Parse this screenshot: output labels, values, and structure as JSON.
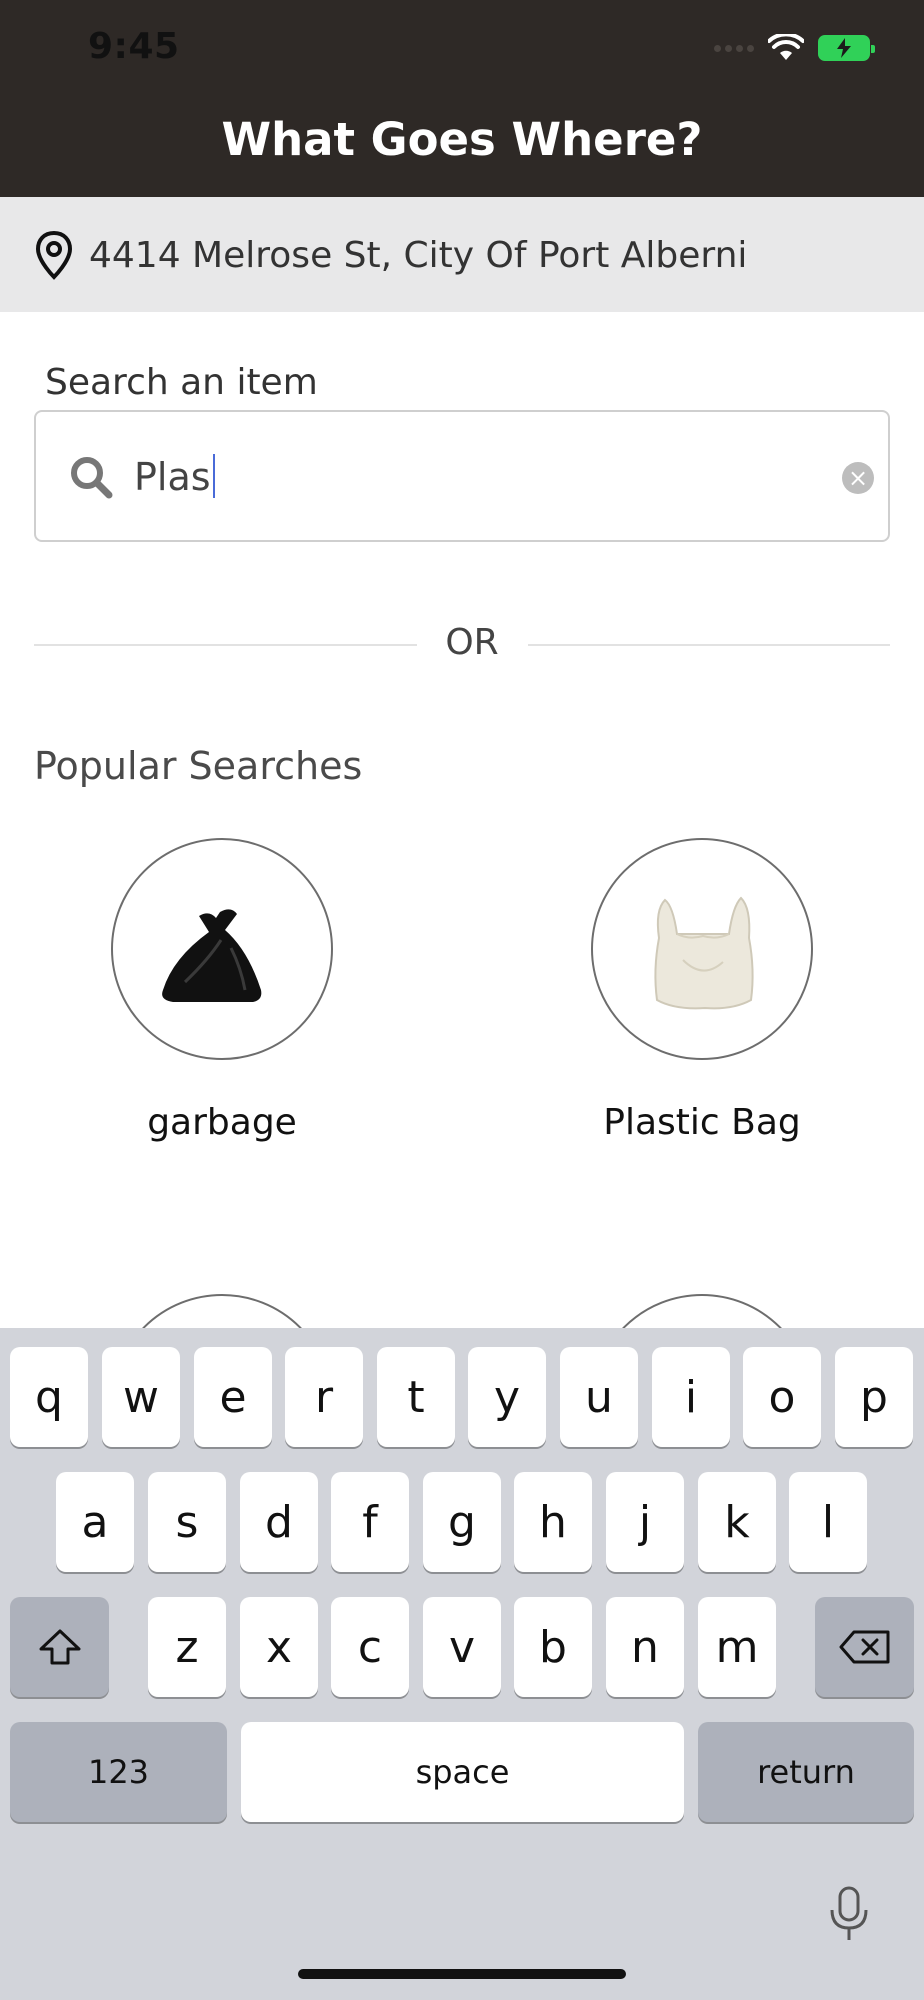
{
  "status_bar": {
    "time": "9:45"
  },
  "header": {
    "title": "What Goes Where?"
  },
  "address": {
    "text": "4414 Melrose St, City Of Port Alberni"
  },
  "search": {
    "label": "Search an item",
    "value": "Plas"
  },
  "divider": {
    "text": "OR"
  },
  "popular": {
    "title": "Popular Searches",
    "items": [
      {
        "label": "garbage",
        "image": "black-garbage-bag"
      },
      {
        "label": "Plastic Bag",
        "image": "white-plastic-bag"
      }
    ]
  },
  "keyboard": {
    "row1": [
      "q",
      "w",
      "e",
      "r",
      "t",
      "y",
      "u",
      "i",
      "o",
      "p"
    ],
    "row2": [
      "a",
      "s",
      "d",
      "f",
      "g",
      "h",
      "j",
      "k",
      "l"
    ],
    "row3": [
      "z",
      "x",
      "c",
      "v",
      "b",
      "n",
      "m"
    ],
    "numbers_label": "123",
    "space_label": "space",
    "return_label": "return"
  },
  "colors": {
    "header_bg": "#2e2926",
    "address_bg": "#e8e8e9",
    "keyboard_bg": "#d2d4da",
    "battery": "#30d158"
  }
}
